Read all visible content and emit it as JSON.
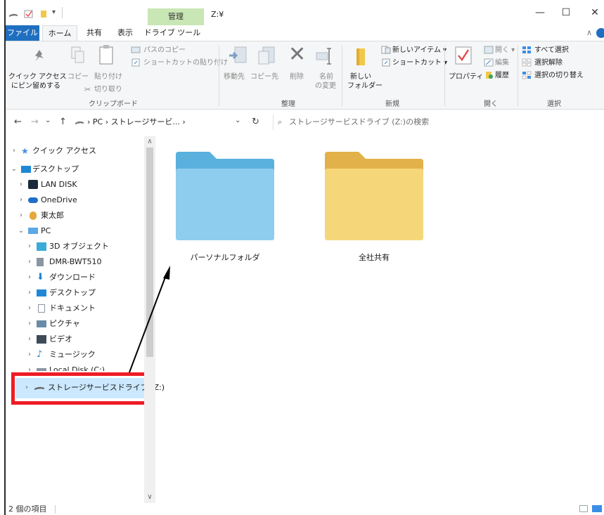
{
  "window": {
    "manage_tab": "管理",
    "title": "Z:¥",
    "minimize": "—",
    "maximize": "☐",
    "close": "✕"
  },
  "ribbon_tabs": {
    "file": "ファイル",
    "home": "ホーム",
    "share": "共有",
    "view": "表示",
    "drive_tools": "ドライブ ツール",
    "collapse": "∧"
  },
  "ribbon": {
    "pin_quick_line1": "クイック アクセス",
    "pin_quick_line2": "にピン留めする",
    "copy": "コピー",
    "paste": "貼り付け",
    "copy_path": "パスのコピー",
    "paste_shortcut": "ショートカットの貼り付け",
    "cut": "切り取り",
    "clipboard_group": "クリップボード",
    "move_to": "移動先",
    "copy_to": "コピー先",
    "delete": "削除",
    "rename_line1": "名前",
    "rename_line2": "の変更",
    "organize_group": "整理",
    "new_item": "新しいアイテム ▾",
    "shortcut": "ショートカット ▾",
    "new_folder_line1": "新しい",
    "new_folder_line2": "フォルダー",
    "new_group": "新規",
    "properties": "プロパティ",
    "open": "開く ▾",
    "edit": "編集",
    "history": "履歴",
    "open_group": "開く",
    "select_all": "すべて選択",
    "select_none": "選択解除",
    "invert_selection": "選択の切り替え",
    "select_group": "選択"
  },
  "address": {
    "back": "←",
    "forward": "→",
    "recent": "⌄",
    "up": "↑",
    "path": "› PC › ストレージサービ... ›",
    "dropdown": "⌄",
    "refresh": "↻",
    "search_placeholder": "ストレージサービスドライブ (Z:)の検索"
  },
  "nav": {
    "items": [
      {
        "chev": "›",
        "label": "クイック アクセス"
      },
      {
        "chev": "⌄",
        "label": "デスクトップ"
      },
      {
        "chev": "›",
        "label": "LAN DISK"
      },
      {
        "chev": "›",
        "label": "OneDrive"
      },
      {
        "chev": "›",
        "label": "東太郎"
      },
      {
        "chev": "⌄",
        "label": "PC"
      },
      {
        "chev": "›",
        "label": "3D オブジェクト"
      },
      {
        "chev": "›",
        "label": "DMR-BWT510"
      },
      {
        "chev": "›",
        "label": "ダウンロード"
      },
      {
        "chev": "›",
        "label": "デスクトップ"
      },
      {
        "chev": "›",
        "label": "ドキュメント"
      },
      {
        "chev": "›",
        "label": "ピクチャ"
      },
      {
        "chev": "›",
        "label": "ビデオ"
      },
      {
        "chev": "›",
        "label": "ミュージック"
      },
      {
        "chev": "›",
        "label": "Local Disk (C:)"
      },
      {
        "chev": "›",
        "label": "ストレージサービスドライブ (Z:)"
      }
    ]
  },
  "content": {
    "folders": [
      {
        "label": "パーソナルフォルダ",
        "color": "#8fcdef"
      },
      {
        "label": "全社共有",
        "color": "#f5d77a"
      }
    ]
  },
  "status": {
    "count": "2 個の項目"
  },
  "colors": {
    "accent": "#1f6fc1",
    "manage_tab": "#c9e6b5",
    "highlight": "#ee1c25",
    "selection": "#cce8ff"
  }
}
